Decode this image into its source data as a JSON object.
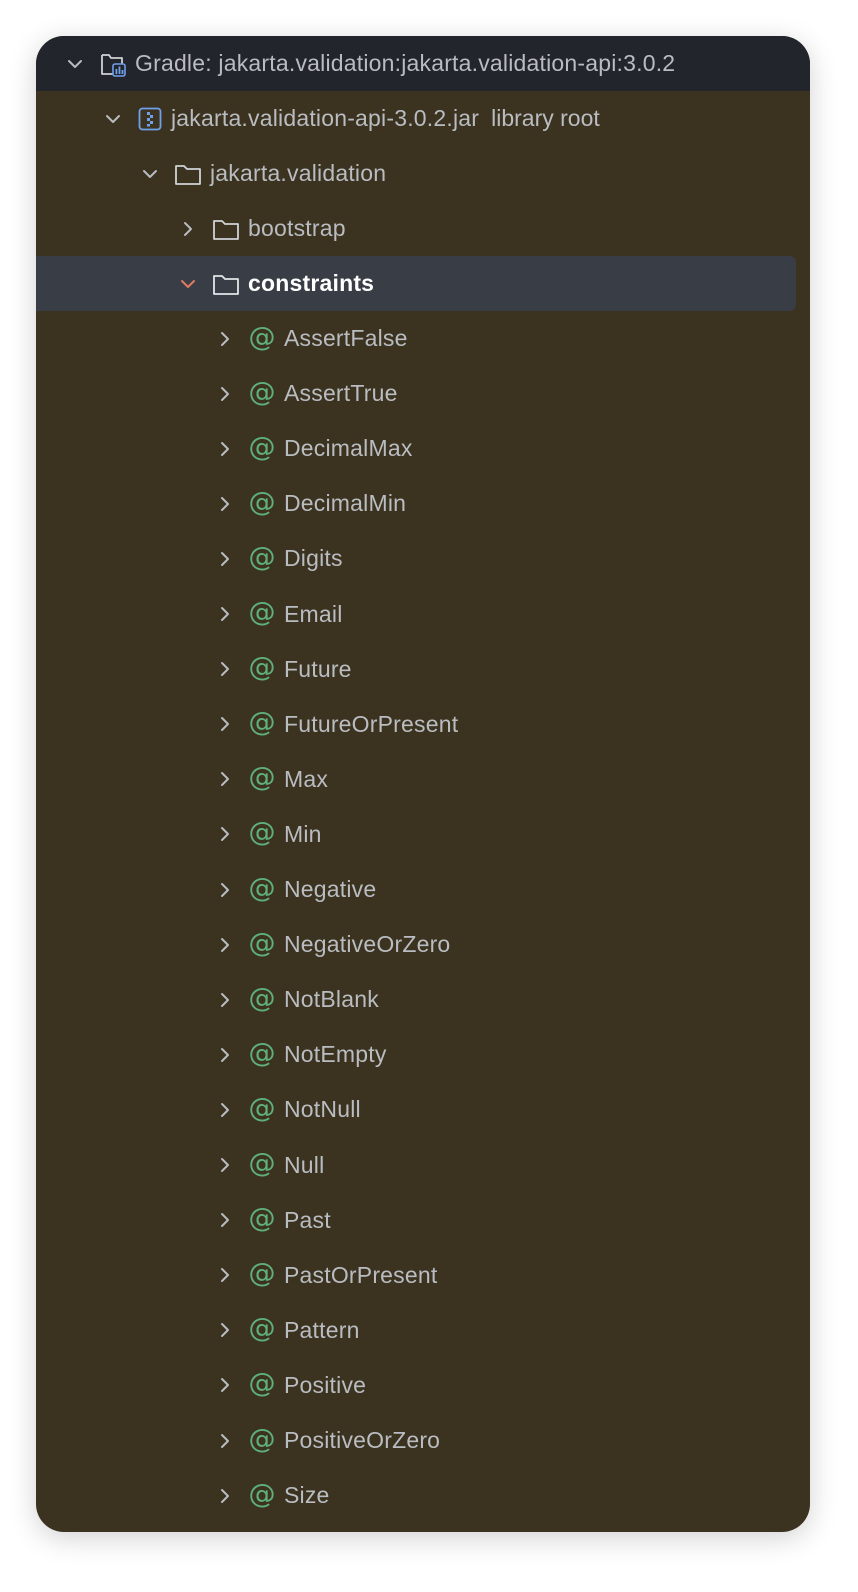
{
  "tree": {
    "root": {
      "label": "Gradle: jakarta.validation:jakarta.validation-api:3.0.2",
      "icon": "gradle-library-icon",
      "expanded": true
    },
    "jar": {
      "label": "jakarta.validation-api-3.0.2.jar",
      "suffix": "library root",
      "icon": "jar-archive-icon",
      "expanded": true
    },
    "package": {
      "label": "jakarta.validation",
      "icon": "folder-icon",
      "expanded": true
    },
    "folders": [
      {
        "label": "bootstrap",
        "icon": "folder-icon",
        "expanded": false,
        "selected": false
      },
      {
        "label": "constraints",
        "icon": "folder-icon",
        "expanded": true,
        "selected": true
      }
    ],
    "annotations": [
      "AssertFalse",
      "AssertTrue",
      "DecimalMax",
      "DecimalMin",
      "Digits",
      "Email",
      "Future",
      "FutureOrPresent",
      "Max",
      "Min",
      "Negative",
      "NegativeOrZero",
      "NotBlank",
      "NotEmpty",
      "NotNull",
      "Null",
      "Past",
      "PastOrPresent",
      "Pattern",
      "Positive",
      "PositiveOrZero",
      "Size"
    ],
    "annotation_glyph": "@"
  },
  "colors": {
    "panel_background": "#3b3320",
    "header_background": "#22252b",
    "selection_background": "#393d45",
    "annotation_icon": "#5fb07a",
    "selected_chevron": "#e07b62",
    "text": "#b9bcc1"
  }
}
